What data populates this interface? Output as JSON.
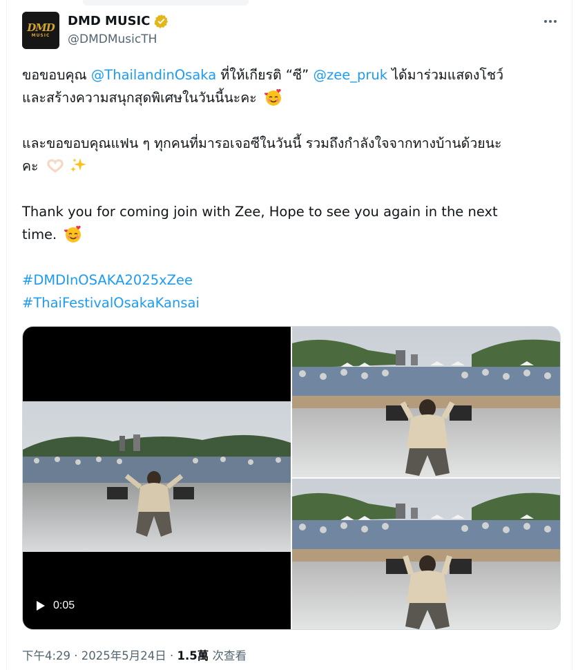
{
  "author": {
    "name": "DMD MUSIC",
    "handle": "@DMDMusicTH",
    "avatar_logo": {
      "top": "DMD",
      "bottom": "MUSIC"
    },
    "verified_color": "#e2b719"
  },
  "colors": {
    "accent": "#1d9bf0",
    "text": "#0f1419",
    "muted": "#536471",
    "border": "#cfd9de"
  },
  "tweet": {
    "line1": {
      "p1": "ขอขอบคุณ ",
      "link1": "@ThailandinOsaka",
      "p2": " ที่ให้เกียรติ “ซี” ",
      "link2": "@zee_pruk",
      "p3": " ได้มาร่วมแสดงโชว์"
    },
    "line2": "และสร้างความสนุกสุดพิเศษในวันนี้นะคะ",
    "line3": "และขอขอบคุณแฟน ๆ ทุกคนที่มารอเจอซีในวันนี้ รวมถึงกำลังใจจากทางบ้านด้วยนะ",
    "line4": "คะ",
    "line5": "Thank you for coming join with Zee, Hope to see you again in the next",
    "line6": "time.",
    "hashtag1": "#DMDInOSAKA2025xZee",
    "hashtag2": "#ThaiFestivalOsakaKansai",
    "emojis": [
      "smiling-face-with-hearts",
      "heart-hands",
      "sparkles",
      "smiling-face-with-hearts"
    ]
  },
  "media": {
    "video": {
      "time": "0:05",
      "icon": "play-icon"
    },
    "photos": [
      "stage-photo-1",
      "stage-photo-2"
    ]
  },
  "footer": {
    "time": "下午4:29 · 2025年5月24日 · ",
    "views": "1.5萬",
    "views_label": " 次查看"
  }
}
